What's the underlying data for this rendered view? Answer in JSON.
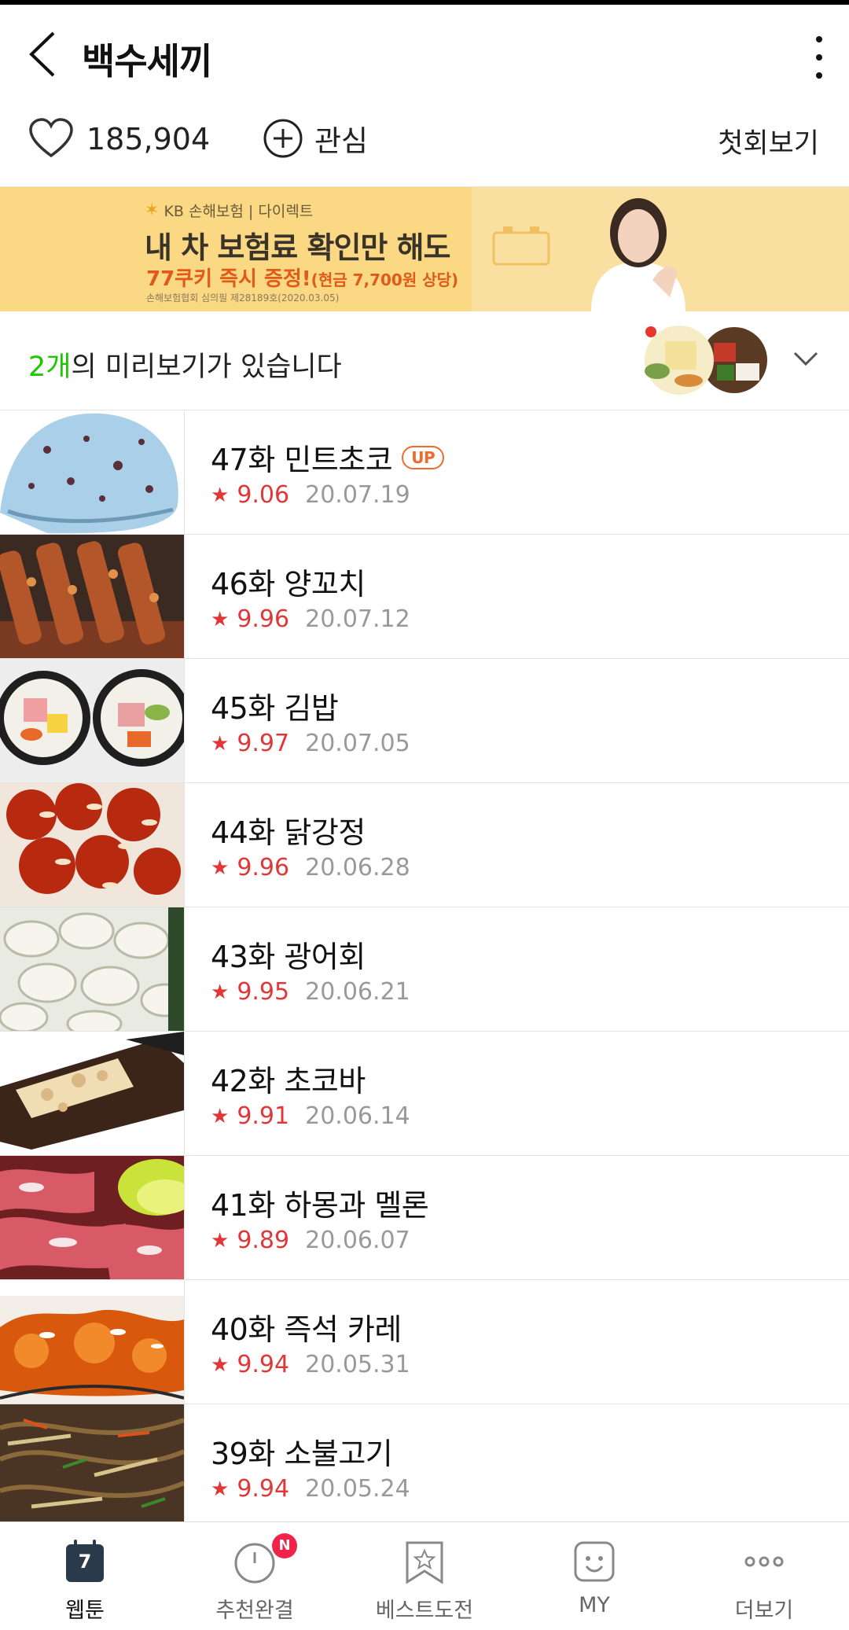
{
  "header": {
    "title": "백수세끼",
    "back_icon": "chevron-left-icon",
    "menu_icon": "more-vertical-icon"
  },
  "stats": {
    "likes": "185,904",
    "favorite_label": "관심",
    "first_episode_label": "첫회보기"
  },
  "ad": {
    "brand": "KB 손해보험 | 다이렉트",
    "line1": "내 차 보험료 확인만 해도",
    "line2_main": "77쿠키 즉시 증정!",
    "line2_sub": "(현금 7,700원 상당)",
    "fine_print": "손해보험협회 심의필 제28189호(2020.03.05)"
  },
  "preview": {
    "count": "2개",
    "text": "의 미리보기가 있습니다"
  },
  "episodes": [
    {
      "title": "47화 민트초코",
      "badge": "UP",
      "rating": "9.06",
      "date": "20.07.19"
    },
    {
      "title": "46화 양꼬치",
      "badge": "",
      "rating": "9.96",
      "date": "20.07.12"
    },
    {
      "title": "45화 김밥",
      "badge": "",
      "rating": "9.97",
      "date": "20.07.05"
    },
    {
      "title": "44화 닭강정",
      "badge": "",
      "rating": "9.96",
      "date": "20.06.28"
    },
    {
      "title": "43화 광어회",
      "badge": "",
      "rating": "9.95",
      "date": "20.06.21"
    },
    {
      "title": "42화 초코바",
      "badge": "",
      "rating": "9.91",
      "date": "20.06.14"
    },
    {
      "title": "41화 하몽과 멜론",
      "badge": "",
      "rating": "9.89",
      "date": "20.06.07"
    },
    {
      "title": "40화 즉석 카레",
      "badge": "",
      "rating": "9.94",
      "date": "20.05.31"
    },
    {
      "title": "39화 소불고기",
      "badge": "",
      "rating": "9.94",
      "date": "20.05.24"
    }
  ],
  "tabbar": {
    "webtoon": {
      "label": "웹툰",
      "day": "7"
    },
    "recommend": {
      "label": "추천완결",
      "badge": "N"
    },
    "best": {
      "label": "베스트도전"
    },
    "my": {
      "label": "MY"
    },
    "more": {
      "label": "더보기"
    }
  },
  "colors": {
    "accent_green": "#1ec800",
    "rating_red": "#e03838",
    "up_orange": "#ef6b2d",
    "ad_bg": "#fbd883"
  }
}
